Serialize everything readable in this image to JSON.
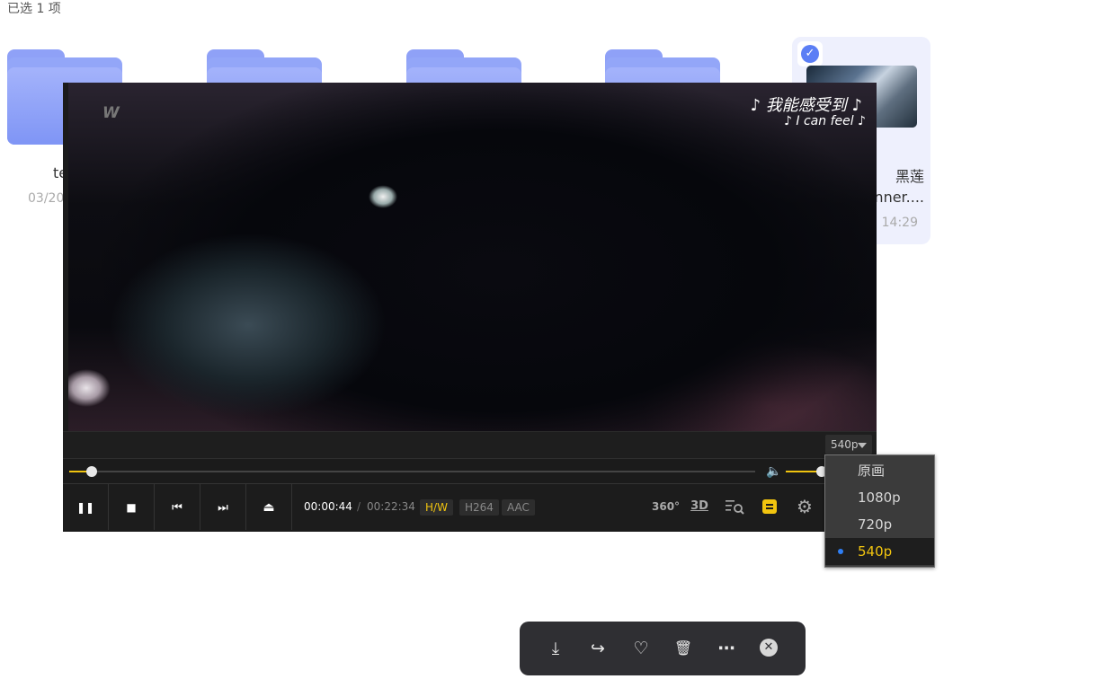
{
  "header": {
    "selection_count": "已选 1 项"
  },
  "folders": [
    {
      "name": "te",
      "date": "03/20"
    },
    {
      "name": "",
      "date": ""
    },
    {
      "name": "",
      "date": ""
    },
    {
      "name": "",
      "date": ""
    }
  ],
  "selected_item": {
    "name_line1": "黑莲",
    "name_line2": "nner....",
    "date": "14:29",
    "checked": true
  },
  "player": {
    "watermark": "W",
    "lyric_line1": "♪ 我能感受到 ♪",
    "lyric_line2": "♪ I can feel ♪",
    "resolution_label": "540p",
    "progress": {
      "current_time": "00:00:44",
      "separator": "/",
      "total_time": "00:22:34",
      "fraction": 0.0325
    },
    "volume_fraction": 0.67,
    "badges": {
      "hw": "H/W",
      "codec": "H264",
      "audio": "AAC"
    },
    "controls": {
      "pause": "❚❚",
      "stop": "■",
      "prev": "⏮",
      "next": "⏭",
      "eject": "⏏",
      "vr": "360°",
      "threed": "3D",
      "settings": "⚙"
    },
    "resolution_menu": [
      {
        "label": "原画",
        "active": false
      },
      {
        "label": "1080p",
        "active": false
      },
      {
        "label": "720p",
        "active": false
      },
      {
        "label": "540p",
        "active": true
      }
    ]
  },
  "action_bar": {
    "download_icon": "⤓",
    "share_icon": "↪",
    "favorite_icon": "♡",
    "delete_icon": "🗑",
    "more_icon": "⋯",
    "close_icon": "✕"
  },
  "colors": {
    "accent": "#f1c40f",
    "folder": "#8fa1f7",
    "selection": "#5b7ef5"
  }
}
